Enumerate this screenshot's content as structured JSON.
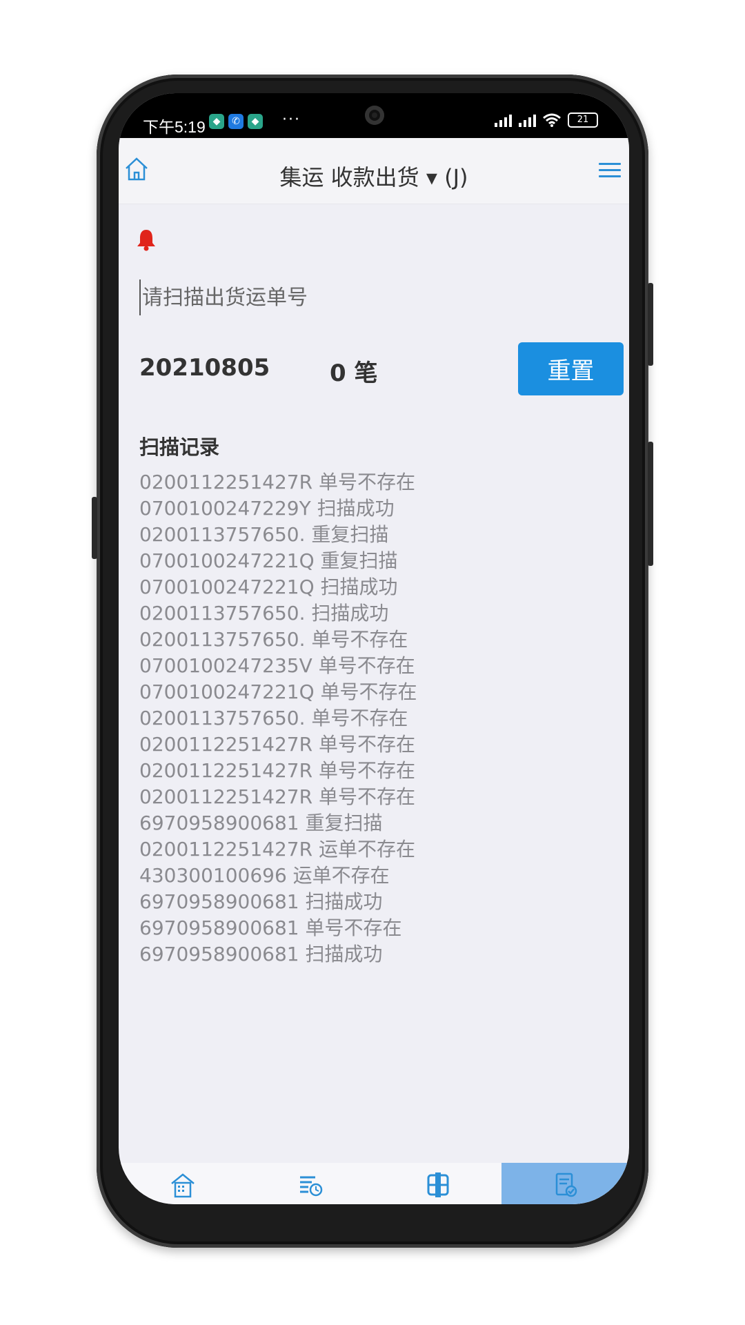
{
  "status_bar": {
    "time": "下午5:19",
    "more": "···",
    "battery": "21"
  },
  "header": {
    "title": "集运 收款出货 ▾ (J)"
  },
  "scan": {
    "placeholder": "请扫描出货运单号"
  },
  "summary": {
    "date": "20210805",
    "count": "0 笔",
    "reset_label": "重置"
  },
  "records": {
    "title": "扫描记录",
    "items": [
      "0200112251427R 单号不存在",
      "0700100247229Y 扫描成功",
      "0200113757650. 重复扫描",
      "0700100247221Q 重复扫描",
      "0700100247221Q 扫描成功",
      "0200113757650. 扫描成功",
      "0200113757650. 单号不存在",
      "0700100247235V 单号不存在",
      "0700100247221Q 单号不存在",
      "0200113757650. 单号不存在",
      "0200112251427R 单号不存在",
      "0200112251427R 单号不存在",
      "0200112251427R 单号不存在",
      "6970958900681 重复扫描",
      "0200112251427R 运单不存在",
      "430300100696 运单不存在",
      "6970958900681 扫描成功",
      "6970958900681 单号不存在",
      "6970958900681 扫描成功"
    ]
  },
  "bottom_nav": [
    {
      "icon": "building-icon",
      "label": "",
      "active": false
    },
    {
      "icon": "list-clock-icon",
      "label": "",
      "active": false
    },
    {
      "icon": "package-icon",
      "label": "",
      "active": false
    },
    {
      "icon": "clipboard-check-icon",
      "label": "",
      "active": true
    }
  ],
  "colors": {
    "accent": "#1b8fe0",
    "bell": "#e0241b",
    "active_tab": "#7db3e8"
  }
}
